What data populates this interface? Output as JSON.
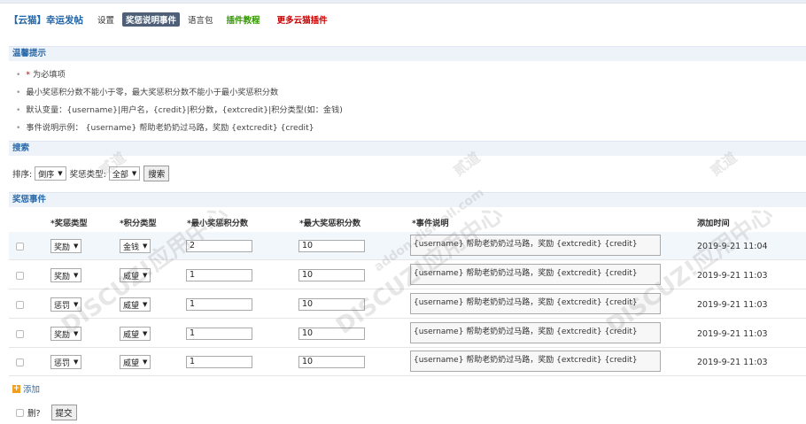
{
  "nav": {
    "brand": "【云猫】幸运发帖",
    "items": [
      {
        "label": "设置",
        "style": ""
      },
      {
        "label": "奖惩说明事件",
        "style": "active"
      },
      {
        "label": "语言包",
        "style": ""
      },
      {
        "label": "插件教程",
        "style": "green"
      },
      {
        "label": "更多云猫插件",
        "style": "red"
      }
    ]
  },
  "tips": {
    "title": "温馨提示",
    "required_star": "*",
    "required_text": "为必填项",
    "line2": "最小奖惩积分数不能小于零，最大奖惩积分数不能小于最小奖惩积分数",
    "line3": "默认变量：{username}|用户名，{credit}|积分数，{extcredit}|积分类型(如：金钱)",
    "line4": "事件说明示例：  {username} 帮助老奶奶过马路，奖励 {extcredit} {credit}"
  },
  "search": {
    "title": "搜索",
    "sort_label": "排序:",
    "sort_value": "倒序",
    "type_label": "奖惩类型:",
    "type_value": "全部",
    "button": "搜索"
  },
  "events": {
    "title": "奖惩事件",
    "headers": {
      "type": "*奖惩类型",
      "credit_type": "*积分类型",
      "min": "*最小奖惩积分数",
      "max": "*最大奖惩积分数",
      "desc": "*事件说明",
      "time": "添加时间"
    },
    "rows": [
      {
        "type": "奖励",
        "credit": "金钱",
        "min": "2",
        "max": "10",
        "desc": "{username} 帮助老奶奶过马路，奖励 {extcredit} {credit}",
        "time": "2019-9-21 11:04"
      },
      {
        "type": "奖励",
        "credit": "威望",
        "min": "1",
        "max": "10",
        "desc": "{username} 帮助老奶奶过马路，奖励 {extcredit} {credit}",
        "time": "2019-9-21 11:03"
      },
      {
        "type": "惩罚",
        "credit": "威望",
        "min": "1",
        "max": "10",
        "desc": "{username} 帮助老奶奶过马路，奖励 {extcredit} {credit}",
        "time": "2019-9-21 11:03"
      },
      {
        "type": "奖励",
        "credit": "威望",
        "min": "1",
        "max": "10",
        "desc": "{username} 帮助老奶奶过马路，奖励 {extcredit} {credit}",
        "time": "2019-9-21 11:03"
      },
      {
        "type": "惩罚",
        "credit": "威望",
        "min": "1",
        "max": "10",
        "desc": "{username} 帮助老奶奶过马路，奖励 {extcredit} {credit}",
        "time": "2019-9-21 11:03"
      }
    ],
    "add_label": "添加"
  },
  "footer": {
    "delete_label": "删?",
    "submit_label": "提交"
  },
  "watermark": {
    "text": "DISCUZ!应用中心",
    "text2": "addon.dismall.com",
    "text3": "贰道"
  }
}
